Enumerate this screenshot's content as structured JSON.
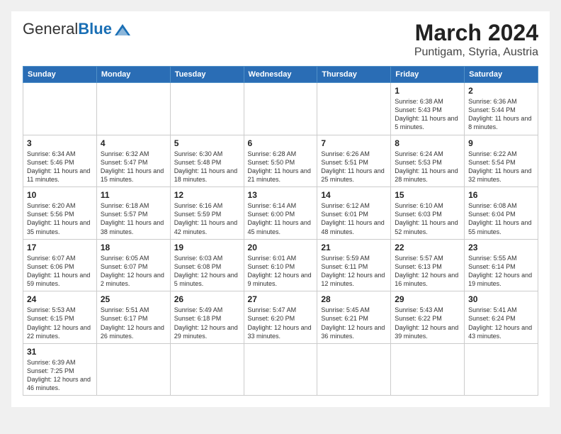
{
  "header": {
    "logo_general": "General",
    "logo_blue": "Blue",
    "title": "March 2024",
    "subtitle": "Puntigam, Styria, Austria"
  },
  "weekdays": [
    "Sunday",
    "Monday",
    "Tuesday",
    "Wednesday",
    "Thursday",
    "Friday",
    "Saturday"
  ],
  "weeks": [
    [
      {
        "day": "",
        "sunrise": "",
        "sunset": "",
        "daylight": ""
      },
      {
        "day": "",
        "sunrise": "",
        "sunset": "",
        "daylight": ""
      },
      {
        "day": "",
        "sunrise": "",
        "sunset": "",
        "daylight": ""
      },
      {
        "day": "",
        "sunrise": "",
        "sunset": "",
        "daylight": ""
      },
      {
        "day": "",
        "sunrise": "",
        "sunset": "",
        "daylight": ""
      },
      {
        "day": "1",
        "sunrise": "Sunrise: 6:38 AM",
        "sunset": "Sunset: 5:43 PM",
        "daylight": "Daylight: 11 hours and 5 minutes."
      },
      {
        "day": "2",
        "sunrise": "Sunrise: 6:36 AM",
        "sunset": "Sunset: 5:44 PM",
        "daylight": "Daylight: 11 hours and 8 minutes."
      }
    ],
    [
      {
        "day": "3",
        "sunrise": "Sunrise: 6:34 AM",
        "sunset": "Sunset: 5:46 PM",
        "daylight": "Daylight: 11 hours and 11 minutes."
      },
      {
        "day": "4",
        "sunrise": "Sunrise: 6:32 AM",
        "sunset": "Sunset: 5:47 PM",
        "daylight": "Daylight: 11 hours and 15 minutes."
      },
      {
        "day": "5",
        "sunrise": "Sunrise: 6:30 AM",
        "sunset": "Sunset: 5:48 PM",
        "daylight": "Daylight: 11 hours and 18 minutes."
      },
      {
        "day": "6",
        "sunrise": "Sunrise: 6:28 AM",
        "sunset": "Sunset: 5:50 PM",
        "daylight": "Daylight: 11 hours and 21 minutes."
      },
      {
        "day": "7",
        "sunrise": "Sunrise: 6:26 AM",
        "sunset": "Sunset: 5:51 PM",
        "daylight": "Daylight: 11 hours and 25 minutes."
      },
      {
        "day": "8",
        "sunrise": "Sunrise: 6:24 AM",
        "sunset": "Sunset: 5:53 PM",
        "daylight": "Daylight: 11 hours and 28 minutes."
      },
      {
        "day": "9",
        "sunrise": "Sunrise: 6:22 AM",
        "sunset": "Sunset: 5:54 PM",
        "daylight": "Daylight: 11 hours and 32 minutes."
      }
    ],
    [
      {
        "day": "10",
        "sunrise": "Sunrise: 6:20 AM",
        "sunset": "Sunset: 5:56 PM",
        "daylight": "Daylight: 11 hours and 35 minutes."
      },
      {
        "day": "11",
        "sunrise": "Sunrise: 6:18 AM",
        "sunset": "Sunset: 5:57 PM",
        "daylight": "Daylight: 11 hours and 38 minutes."
      },
      {
        "day": "12",
        "sunrise": "Sunrise: 6:16 AM",
        "sunset": "Sunset: 5:59 PM",
        "daylight": "Daylight: 11 hours and 42 minutes."
      },
      {
        "day": "13",
        "sunrise": "Sunrise: 6:14 AM",
        "sunset": "Sunset: 6:00 PM",
        "daylight": "Daylight: 11 hours and 45 minutes."
      },
      {
        "day": "14",
        "sunrise": "Sunrise: 6:12 AM",
        "sunset": "Sunset: 6:01 PM",
        "daylight": "Daylight: 11 hours and 48 minutes."
      },
      {
        "day": "15",
        "sunrise": "Sunrise: 6:10 AM",
        "sunset": "Sunset: 6:03 PM",
        "daylight": "Daylight: 11 hours and 52 minutes."
      },
      {
        "day": "16",
        "sunrise": "Sunrise: 6:08 AM",
        "sunset": "Sunset: 6:04 PM",
        "daylight": "Daylight: 11 hours and 55 minutes."
      }
    ],
    [
      {
        "day": "17",
        "sunrise": "Sunrise: 6:07 AM",
        "sunset": "Sunset: 6:06 PM",
        "daylight": "Daylight: 11 hours and 59 minutes."
      },
      {
        "day": "18",
        "sunrise": "Sunrise: 6:05 AM",
        "sunset": "Sunset: 6:07 PM",
        "daylight": "Daylight: 12 hours and 2 minutes."
      },
      {
        "day": "19",
        "sunrise": "Sunrise: 6:03 AM",
        "sunset": "Sunset: 6:08 PM",
        "daylight": "Daylight: 12 hours and 5 minutes."
      },
      {
        "day": "20",
        "sunrise": "Sunrise: 6:01 AM",
        "sunset": "Sunset: 6:10 PM",
        "daylight": "Daylight: 12 hours and 9 minutes."
      },
      {
        "day": "21",
        "sunrise": "Sunrise: 5:59 AM",
        "sunset": "Sunset: 6:11 PM",
        "daylight": "Daylight: 12 hours and 12 minutes."
      },
      {
        "day": "22",
        "sunrise": "Sunrise: 5:57 AM",
        "sunset": "Sunset: 6:13 PM",
        "daylight": "Daylight: 12 hours and 16 minutes."
      },
      {
        "day": "23",
        "sunrise": "Sunrise: 5:55 AM",
        "sunset": "Sunset: 6:14 PM",
        "daylight": "Daylight: 12 hours and 19 minutes."
      }
    ],
    [
      {
        "day": "24",
        "sunrise": "Sunrise: 5:53 AM",
        "sunset": "Sunset: 6:15 PM",
        "daylight": "Daylight: 12 hours and 22 minutes."
      },
      {
        "day": "25",
        "sunrise": "Sunrise: 5:51 AM",
        "sunset": "Sunset: 6:17 PM",
        "daylight": "Daylight: 12 hours and 26 minutes."
      },
      {
        "day": "26",
        "sunrise": "Sunrise: 5:49 AM",
        "sunset": "Sunset: 6:18 PM",
        "daylight": "Daylight: 12 hours and 29 minutes."
      },
      {
        "day": "27",
        "sunrise": "Sunrise: 5:47 AM",
        "sunset": "Sunset: 6:20 PM",
        "daylight": "Daylight: 12 hours and 33 minutes."
      },
      {
        "day": "28",
        "sunrise": "Sunrise: 5:45 AM",
        "sunset": "Sunset: 6:21 PM",
        "daylight": "Daylight: 12 hours and 36 minutes."
      },
      {
        "day": "29",
        "sunrise": "Sunrise: 5:43 AM",
        "sunset": "Sunset: 6:22 PM",
        "daylight": "Daylight: 12 hours and 39 minutes."
      },
      {
        "day": "30",
        "sunrise": "Sunrise: 5:41 AM",
        "sunset": "Sunset: 6:24 PM",
        "daylight": "Daylight: 12 hours and 43 minutes."
      }
    ],
    [
      {
        "day": "31",
        "sunrise": "Sunrise: 6:39 AM",
        "sunset": "Sunset: 7:25 PM",
        "daylight": "Daylight: 12 hours and 46 minutes."
      },
      {
        "day": "",
        "sunrise": "",
        "sunset": "",
        "daylight": ""
      },
      {
        "day": "",
        "sunrise": "",
        "sunset": "",
        "daylight": ""
      },
      {
        "day": "",
        "sunrise": "",
        "sunset": "",
        "daylight": ""
      },
      {
        "day": "",
        "sunrise": "",
        "sunset": "",
        "daylight": ""
      },
      {
        "day": "",
        "sunrise": "",
        "sunset": "",
        "daylight": ""
      },
      {
        "day": "",
        "sunrise": "",
        "sunset": "",
        "daylight": ""
      }
    ]
  ]
}
